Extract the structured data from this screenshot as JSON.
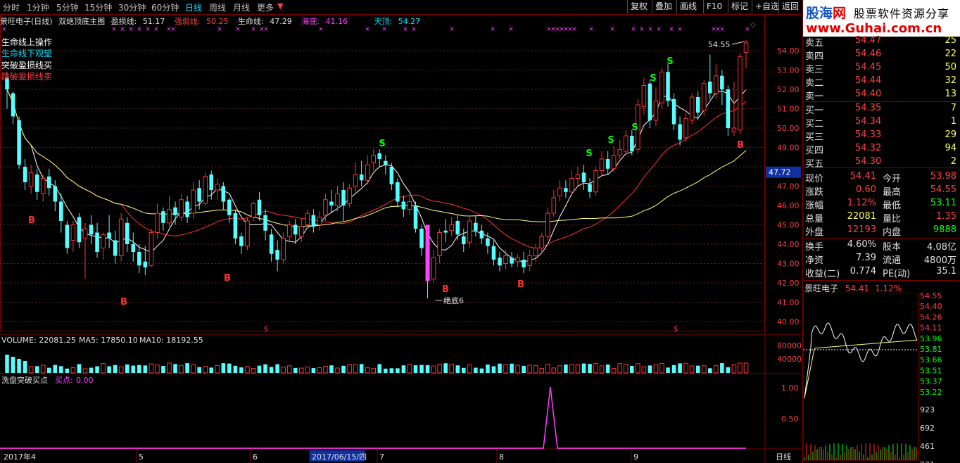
{
  "periods": [
    "分时",
    "1分钟",
    "5分钟",
    "15分钟",
    "30分钟",
    "60分钟",
    "日线",
    "周线",
    "月线",
    "更多"
  ],
  "active_period": "日线",
  "toolbar": [
    "复权",
    "叠加",
    "画线",
    "F10",
    "标记",
    "+自选",
    "返回"
  ],
  "legend": {
    "name": "景旺电子(日线)",
    "indicator": "双绝顶底主图",
    "profit_loss_label": "盈损线:",
    "profit_loss_value": "51.17",
    "strong_weak_label": "强弱线:",
    "strong_weak_value": "50.25",
    "lifeline_label": "生命线:",
    "lifeline_value": "47.29",
    "sea_bottom_label": "海底:",
    "sea_bottom_value": "41.16",
    "sky_top_label": "天顶:",
    "sky_top_value": "54.27"
  },
  "signals": [
    {
      "text": "生命线上操作",
      "color": "#ffffff"
    },
    {
      "text": "生命线下观望",
      "color": "#00e0ff"
    },
    {
      "text": "突破盈损线买",
      "color": "#ffffff"
    },
    {
      "text": "跌破盈损线卖",
      "color": "#ff4040"
    }
  ],
  "price_axis": [
    "54.00",
    "53.00",
    "52.00",
    "51.00",
    "50.00",
    "49.00",
    "47.72",
    "47.00",
    "46.00",
    "45.00",
    "44.00",
    "43.00",
    "42.00",
    "41.00",
    "40.00"
  ],
  "crosshair_price": "47.72",
  "high_label": "54.55",
  "low_label": "绝底6",
  "bottom_label_left": "一",
  "markers": {
    "S": "S",
    "B": "B",
    "dollar": "$"
  },
  "volume_legend": {
    "text": "VOLUME: 22081.25",
    "ma5": "MA5: 17850.10",
    "ma10": "MA10: 18192.55"
  },
  "volume_axis": [
    "80000",
    "40000"
  ],
  "sub_legend": {
    "name": "洗盘突破买点",
    "buy_label": "买点:",
    "buy_value": "0.00"
  },
  "sub_axis": [
    "1.00",
    "0.50"
  ],
  "date_axis": [
    "2017年4",
    "5",
    "6",
    "2017/06/15/四",
    "7",
    "8",
    "9"
  ],
  "period_label": "日线",
  "chart_data": {
    "type": "candlestick",
    "title": "景旺电子(日线)",
    "ylim": [
      40,
      55
    ],
    "candles": [
      [
        52.6,
        52.0,
        52.9,
        51.0,
        1
      ],
      [
        51.8,
        50.6,
        51.9,
        50.2,
        1
      ],
      [
        50.4,
        48.1,
        50.6,
        47.9,
        1
      ],
      [
        48.0,
        47.2,
        48.4,
        46.8,
        1
      ],
      [
        47.0,
        47.7,
        48.1,
        46.6,
        0
      ],
      [
        47.6,
        46.7,
        47.9,
        46.3,
        1
      ],
      [
        46.6,
        47.4,
        47.6,
        46.2,
        0
      ],
      [
        47.5,
        46.9,
        47.9,
        46.5,
        1
      ],
      [
        47.0,
        46.2,
        47.3,
        45.7,
        1
      ],
      [
        46.2,
        45.2,
        46.6,
        44.6,
        1
      ],
      [
        45.0,
        43.8,
        45.2,
        43.5,
        1
      ],
      [
        44.2,
        45.0,
        45.2,
        43.6,
        0
      ],
      [
        45.4,
        44.1,
        45.6,
        43.8,
        1
      ],
      [
        44.3,
        44.8,
        45.1,
        42.2,
        0
      ],
      [
        45.0,
        44.5,
        45.5,
        44.0,
        1
      ],
      [
        44.6,
        43.6,
        45.1,
        43.3,
        1
      ],
      [
        43.8,
        44.5,
        44.6,
        43.2,
        0
      ],
      [
        44.6,
        44.3,
        45.5,
        43.8,
        1
      ],
      [
        44.2,
        43.4,
        44.7,
        43.0,
        1
      ],
      [
        43.4,
        45.3,
        45.6,
        43.1,
        0
      ],
      [
        45.1,
        44.0,
        45.4,
        43.6,
        1
      ],
      [
        44.0,
        43.6,
        44.6,
        43.1,
        1
      ],
      [
        43.6,
        42.9,
        44.0,
        42.5,
        1
      ],
      [
        43.1,
        42.8,
        43.9,
        42.4,
        1
      ],
      [
        42.9,
        44.6,
        44.8,
        42.8,
        0
      ],
      [
        44.6,
        45.6,
        46.1,
        44.3,
        0
      ],
      [
        45.7,
        45.1,
        45.9,
        44.7,
        1
      ],
      [
        45.1,
        45.8,
        46.5,
        44.9,
        0
      ],
      [
        45.9,
        45.5,
        46.2,
        45.0,
        1
      ],
      [
        45.4,
        46.3,
        46.6,
        45.2,
        0
      ],
      [
        46.2,
        45.4,
        46.5,
        45.1,
        1
      ],
      [
        45.6,
        46.8,
        47.2,
        45.3,
        0
      ],
      [
        46.9,
        46.2,
        47.3,
        45.8,
        1
      ],
      [
        46.1,
        47.5,
        47.7,
        46.0,
        0
      ],
      [
        47.6,
        46.8,
        47.8,
        46.3,
        1
      ],
      [
        46.8,
        47.1,
        47.4,
        46.3,
        0
      ],
      [
        47.0,
        46.2,
        47.2,
        45.8,
        1
      ],
      [
        46.3,
        45.5,
        46.4,
        45.1,
        1
      ],
      [
        45.6,
        44.3,
        45.8,
        44.0,
        1
      ],
      [
        44.4,
        43.9,
        44.6,
        43.5,
        1
      ],
      [
        43.9,
        45.2,
        45.4,
        43.7,
        0
      ],
      [
        45.4,
        46.1,
        46.2,
        45.2,
        0
      ],
      [
        46.3,
        45.5,
        46.7,
        45.2,
        1
      ],
      [
        45.5,
        44.7,
        45.8,
        44.2,
        1
      ],
      [
        44.5,
        43.5,
        44.8,
        43.1,
        1
      ],
      [
        43.7,
        43.2,
        44.2,
        42.6,
        1
      ],
      [
        43.2,
        44.3,
        44.6,
        43.0,
        0
      ],
      [
        44.4,
        45.0,
        45.2,
        44.1,
        0
      ],
      [
        45.0,
        44.5,
        45.3,
        44.0,
        1
      ],
      [
        44.4,
        44.9,
        45.3,
        44.1,
        0
      ],
      [
        45.0,
        45.6,
        45.8,
        44.8,
        0
      ],
      [
        45.5,
        44.9,
        45.8,
        44.6,
        1
      ],
      [
        45.0,
        45.4,
        45.7,
        44.7,
        0
      ],
      [
        45.5,
        46.3,
        46.6,
        45.2,
        0
      ],
      [
        46.2,
        46.0,
        46.8,
        45.6,
        1
      ],
      [
        46.0,
        46.6,
        47.0,
        45.7,
        0
      ],
      [
        46.8,
        46.0,
        47.2,
        45.2,
        1
      ],
      [
        46.1,
        46.9,
        47.1,
        45.9,
        0
      ],
      [
        47.0,
        47.6,
        48.2,
        46.7,
        0
      ],
      [
        47.6,
        47.3,
        48.3,
        47.0,
        1
      ],
      [
        47.3,
        48.1,
        48.6,
        47.1,
        0
      ],
      [
        48.2,
        48.6,
        48.9,
        47.8,
        0
      ],
      [
        48.7,
        48.4,
        48.9,
        48.0,
        1
      ],
      [
        48.3,
        48.1,
        48.6,
        47.6,
        1
      ],
      [
        48.0,
        47.1,
        48.2,
        46.8,
        1
      ],
      [
        47.2,
        46.2,
        47.4,
        45.9,
        1
      ],
      [
        46.2,
        45.8,
        46.5,
        45.4,
        1
      ],
      [
        45.8,
        46.2,
        46.5,
        45.5,
        0
      ],
      [
        46.0,
        44.8,
        46.2,
        44.6,
        1
      ],
      [
        44.8,
        43.8,
        45.0,
        43.4,
        1
      ],
      [
        43.8,
        42.1,
        44.4,
        41.2,
        1
      ],
      [
        42.2,
        43.3,
        43.7,
        42.0,
        0
      ],
      [
        43.4,
        44.6,
        44.8,
        43.0,
        0
      ],
      [
        44.6,
        44.7,
        45.3,
        44.1,
        1
      ],
      [
        44.7,
        45.0,
        45.4,
        44.4,
        0
      ],
      [
        45.2,
        44.5,
        45.5,
        44.2,
        1
      ],
      [
        44.4,
        44.0,
        44.8,
        43.6,
        1
      ],
      [
        44.1,
        45.2,
        45.4,
        43.8,
        0
      ],
      [
        45.1,
        44.7,
        45.5,
        44.4,
        1
      ],
      [
        44.7,
        44.3,
        45.0,
        44.0,
        1
      ],
      [
        44.3,
        43.9,
        44.6,
        43.5,
        1
      ],
      [
        43.9,
        43.2,
        44.2,
        42.9,
        1
      ],
      [
        43.3,
        42.9,
        43.6,
        42.6,
        1
      ],
      [
        43.0,
        43.4,
        43.7,
        42.7,
        0
      ],
      [
        43.3,
        43.0,
        43.6,
        42.8,
        1
      ],
      [
        43.1,
        43.3,
        43.5,
        42.8,
        0
      ],
      [
        43.2,
        42.8,
        43.6,
        42.5,
        1
      ],
      [
        42.9,
        43.4,
        43.7,
        42.6,
        0
      ],
      [
        43.4,
        43.8,
        44.0,
        43.1,
        0
      ],
      [
        43.8,
        44.4,
        44.6,
        43.5,
        0
      ],
      [
        44.4,
        45.6,
        45.9,
        44.2,
        0
      ],
      [
        45.6,
        46.4,
        46.8,
        45.4,
        0
      ],
      [
        46.5,
        46.9,
        47.3,
        46.2,
        0
      ],
      [
        46.9,
        46.7,
        47.3,
        46.4,
        1
      ],
      [
        46.7,
        47.4,
        47.8,
        46.5,
        0
      ],
      [
        47.4,
        47.6,
        48.0,
        47.0,
        0
      ],
      [
        47.7,
        47.2,
        48.1,
        46.8,
        1
      ],
      [
        47.1,
        46.7,
        47.4,
        46.4,
        1
      ],
      [
        46.7,
        47.8,
        48.0,
        46.5,
        0
      ],
      [
        47.8,
        48.4,
        48.8,
        47.5,
        0
      ],
      [
        48.4,
        47.9,
        48.8,
        47.6,
        1
      ],
      [
        47.9,
        48.6,
        49.1,
        47.7,
        0
      ],
      [
        48.6,
        48.9,
        49.4,
        48.4,
        0
      ],
      [
        48.8,
        49.6,
        49.9,
        48.6,
        0
      ],
      [
        49.6,
        48.8,
        49.9,
        48.6,
        1
      ],
      [
        48.9,
        51.2,
        51.5,
        48.7,
        0
      ],
      [
        51.1,
        52.2,
        52.6,
        50.7,
        0
      ],
      [
        52.3,
        50.4,
        52.5,
        50.0,
        1
      ],
      [
        50.4,
        51.4,
        52.1,
        50.1,
        0
      ],
      [
        51.3,
        52.9,
        53.1,
        51.0,
        0
      ],
      [
        52.9,
        51.4,
        53.3,
        51.1,
        1
      ],
      [
        51.5,
        50.2,
        51.8,
        49.9,
        1
      ],
      [
        50.2,
        49.4,
        50.6,
        49.1,
        1
      ],
      [
        49.5,
        50.5,
        50.8,
        49.3,
        0
      ],
      [
        50.4,
        51.6,
        51.8,
        50.2,
        0
      ],
      [
        51.6,
        50.8,
        51.9,
        50.4,
        1
      ],
      [
        50.9,
        52.3,
        52.5,
        50.6,
        0
      ],
      [
        52.4,
        51.8,
        53.8,
        51.5,
        1
      ],
      [
        51.8,
        52.7,
        53.3,
        51.5,
        0
      ],
      [
        52.7,
        52.0,
        53.0,
        51.2,
        1
      ],
      [
        52.0,
        50.0,
        52.2,
        49.6,
        1
      ],
      [
        50.0,
        49.8,
        52.4,
        49.6,
        0
      ],
      [
        49.9,
        53.7,
        53.9,
        49.7,
        0
      ],
      [
        53.9,
        54.4,
        54.55,
        53.1,
        0
      ]
    ]
  }
}
